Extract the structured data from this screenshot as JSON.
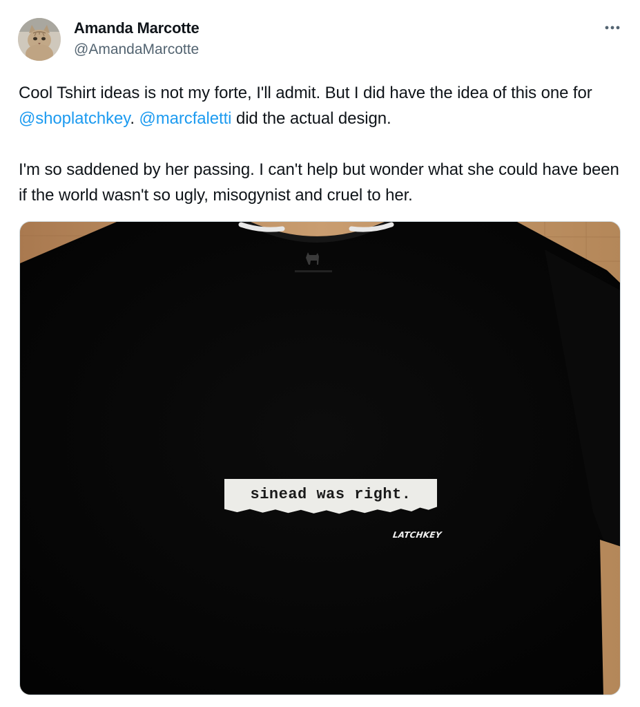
{
  "author": {
    "display_name": "Amanda Marcotte",
    "handle": "@AmandaMarcotte",
    "avatar_icon": "cat-avatar-icon"
  },
  "more_icon": "more-horizontal-icon",
  "tweet": {
    "para1_before": "Cool Tshirt ideas is not my forte, I'll admit. But I did have the idea of this one for ",
    "mention1": "@shoplatchkey",
    "para1_mid": ". ",
    "mention2": "@marcfaletti",
    "para1_after": " did the actual design.",
    "para2": "I'm so saddened by her passing. I can't help but wonder what she could have been if the world wasn't so ugly, misogynist and cruel to her."
  },
  "media": {
    "shirt_print": "sinead was right.",
    "brand_mark": "LATCHKEY"
  },
  "colors": {
    "link": "#1d9bf0",
    "secondary_text": "#536471",
    "primary_text": "#0f1419",
    "shirt": "#070707",
    "wood": "#b88a5c"
  }
}
